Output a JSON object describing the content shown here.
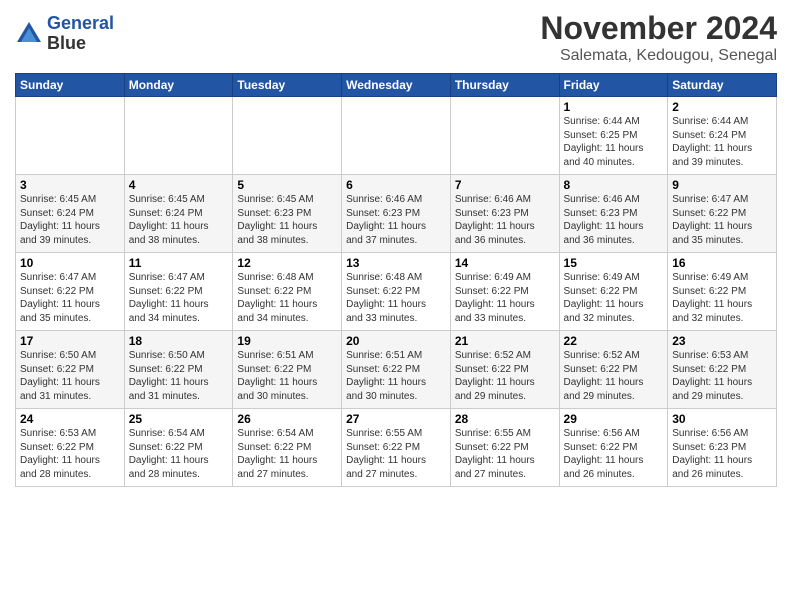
{
  "header": {
    "logo_line1": "General",
    "logo_line2": "Blue",
    "month": "November 2024",
    "location": "Salemata, Kedougou, Senegal"
  },
  "days_of_week": [
    "Sunday",
    "Monday",
    "Tuesday",
    "Wednesday",
    "Thursday",
    "Friday",
    "Saturday"
  ],
  "weeks": [
    [
      {
        "day": "",
        "info": ""
      },
      {
        "day": "",
        "info": ""
      },
      {
        "day": "",
        "info": ""
      },
      {
        "day": "",
        "info": ""
      },
      {
        "day": "",
        "info": ""
      },
      {
        "day": "1",
        "info": "Sunrise: 6:44 AM\nSunset: 6:25 PM\nDaylight: 11 hours\nand 40 minutes."
      },
      {
        "day": "2",
        "info": "Sunrise: 6:44 AM\nSunset: 6:24 PM\nDaylight: 11 hours\nand 39 minutes."
      }
    ],
    [
      {
        "day": "3",
        "info": "Sunrise: 6:45 AM\nSunset: 6:24 PM\nDaylight: 11 hours\nand 39 minutes."
      },
      {
        "day": "4",
        "info": "Sunrise: 6:45 AM\nSunset: 6:24 PM\nDaylight: 11 hours\nand 38 minutes."
      },
      {
        "day": "5",
        "info": "Sunrise: 6:45 AM\nSunset: 6:23 PM\nDaylight: 11 hours\nand 38 minutes."
      },
      {
        "day": "6",
        "info": "Sunrise: 6:46 AM\nSunset: 6:23 PM\nDaylight: 11 hours\nand 37 minutes."
      },
      {
        "day": "7",
        "info": "Sunrise: 6:46 AM\nSunset: 6:23 PM\nDaylight: 11 hours\nand 36 minutes."
      },
      {
        "day": "8",
        "info": "Sunrise: 6:46 AM\nSunset: 6:23 PM\nDaylight: 11 hours\nand 36 minutes."
      },
      {
        "day": "9",
        "info": "Sunrise: 6:47 AM\nSunset: 6:22 PM\nDaylight: 11 hours\nand 35 minutes."
      }
    ],
    [
      {
        "day": "10",
        "info": "Sunrise: 6:47 AM\nSunset: 6:22 PM\nDaylight: 11 hours\nand 35 minutes."
      },
      {
        "day": "11",
        "info": "Sunrise: 6:47 AM\nSunset: 6:22 PM\nDaylight: 11 hours\nand 34 minutes."
      },
      {
        "day": "12",
        "info": "Sunrise: 6:48 AM\nSunset: 6:22 PM\nDaylight: 11 hours\nand 34 minutes."
      },
      {
        "day": "13",
        "info": "Sunrise: 6:48 AM\nSunset: 6:22 PM\nDaylight: 11 hours\nand 33 minutes."
      },
      {
        "day": "14",
        "info": "Sunrise: 6:49 AM\nSunset: 6:22 PM\nDaylight: 11 hours\nand 33 minutes."
      },
      {
        "day": "15",
        "info": "Sunrise: 6:49 AM\nSunset: 6:22 PM\nDaylight: 11 hours\nand 32 minutes."
      },
      {
        "day": "16",
        "info": "Sunrise: 6:49 AM\nSunset: 6:22 PM\nDaylight: 11 hours\nand 32 minutes."
      }
    ],
    [
      {
        "day": "17",
        "info": "Sunrise: 6:50 AM\nSunset: 6:22 PM\nDaylight: 11 hours\nand 31 minutes."
      },
      {
        "day": "18",
        "info": "Sunrise: 6:50 AM\nSunset: 6:22 PM\nDaylight: 11 hours\nand 31 minutes."
      },
      {
        "day": "19",
        "info": "Sunrise: 6:51 AM\nSunset: 6:22 PM\nDaylight: 11 hours\nand 30 minutes."
      },
      {
        "day": "20",
        "info": "Sunrise: 6:51 AM\nSunset: 6:22 PM\nDaylight: 11 hours\nand 30 minutes."
      },
      {
        "day": "21",
        "info": "Sunrise: 6:52 AM\nSunset: 6:22 PM\nDaylight: 11 hours\nand 29 minutes."
      },
      {
        "day": "22",
        "info": "Sunrise: 6:52 AM\nSunset: 6:22 PM\nDaylight: 11 hours\nand 29 minutes."
      },
      {
        "day": "23",
        "info": "Sunrise: 6:53 AM\nSunset: 6:22 PM\nDaylight: 11 hours\nand 29 minutes."
      }
    ],
    [
      {
        "day": "24",
        "info": "Sunrise: 6:53 AM\nSunset: 6:22 PM\nDaylight: 11 hours\nand 28 minutes."
      },
      {
        "day": "25",
        "info": "Sunrise: 6:54 AM\nSunset: 6:22 PM\nDaylight: 11 hours\nand 28 minutes."
      },
      {
        "day": "26",
        "info": "Sunrise: 6:54 AM\nSunset: 6:22 PM\nDaylight: 11 hours\nand 27 minutes."
      },
      {
        "day": "27",
        "info": "Sunrise: 6:55 AM\nSunset: 6:22 PM\nDaylight: 11 hours\nand 27 minutes."
      },
      {
        "day": "28",
        "info": "Sunrise: 6:55 AM\nSunset: 6:22 PM\nDaylight: 11 hours\nand 27 minutes."
      },
      {
        "day": "29",
        "info": "Sunrise: 6:56 AM\nSunset: 6:22 PM\nDaylight: 11 hours\nand 26 minutes."
      },
      {
        "day": "30",
        "info": "Sunrise: 6:56 AM\nSunset: 6:23 PM\nDaylight: 11 hours\nand 26 minutes."
      }
    ]
  ]
}
